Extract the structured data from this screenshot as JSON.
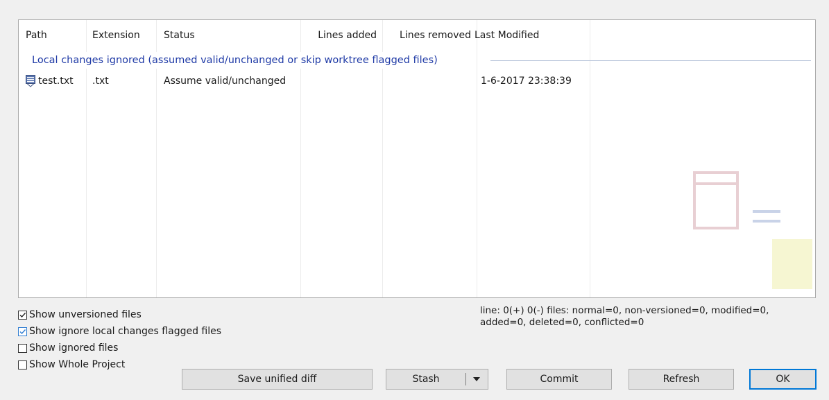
{
  "columns": [
    "Path",
    "Extension",
    "Status",
    "Lines added",
    "Lines removed",
    "Last Modified"
  ],
  "group": {
    "label": "Local changes ignored (assumed valid/unchanged or skip worktree flagged files)"
  },
  "rows": [
    {
      "path": "test.txt",
      "extension": ".txt",
      "status": "Assume valid/unchanged",
      "lines_added": "",
      "lines_removed": "",
      "last_modified": "1-6-2017 23:38:39",
      "icon": "file-ignored-icon"
    }
  ],
  "options": [
    {
      "label": "Show unversioned files",
      "checked": true
    },
    {
      "label": "Show ignore local changes flagged files",
      "checked": true
    },
    {
      "label": "Show ignored files",
      "checked": false
    },
    {
      "label": "Show Whole Project",
      "checked": false
    }
  ],
  "stats": {
    "line1": "line: 0(+) 0(-) files: normal=0, non-versioned=0, modified=0,",
    "line2": "added=0, deleted=0, conflicted=0"
  },
  "buttons": {
    "save_unified_diff": "Save unified diff",
    "stash": "Stash",
    "commit": "Commit",
    "refresh": "Refresh",
    "ok": "OK"
  },
  "icons": {
    "stash_dropdown": "chevron-down-icon"
  },
  "colors": {
    "group_text": "#1f3aa6",
    "default_button_border": "#0078d7"
  }
}
